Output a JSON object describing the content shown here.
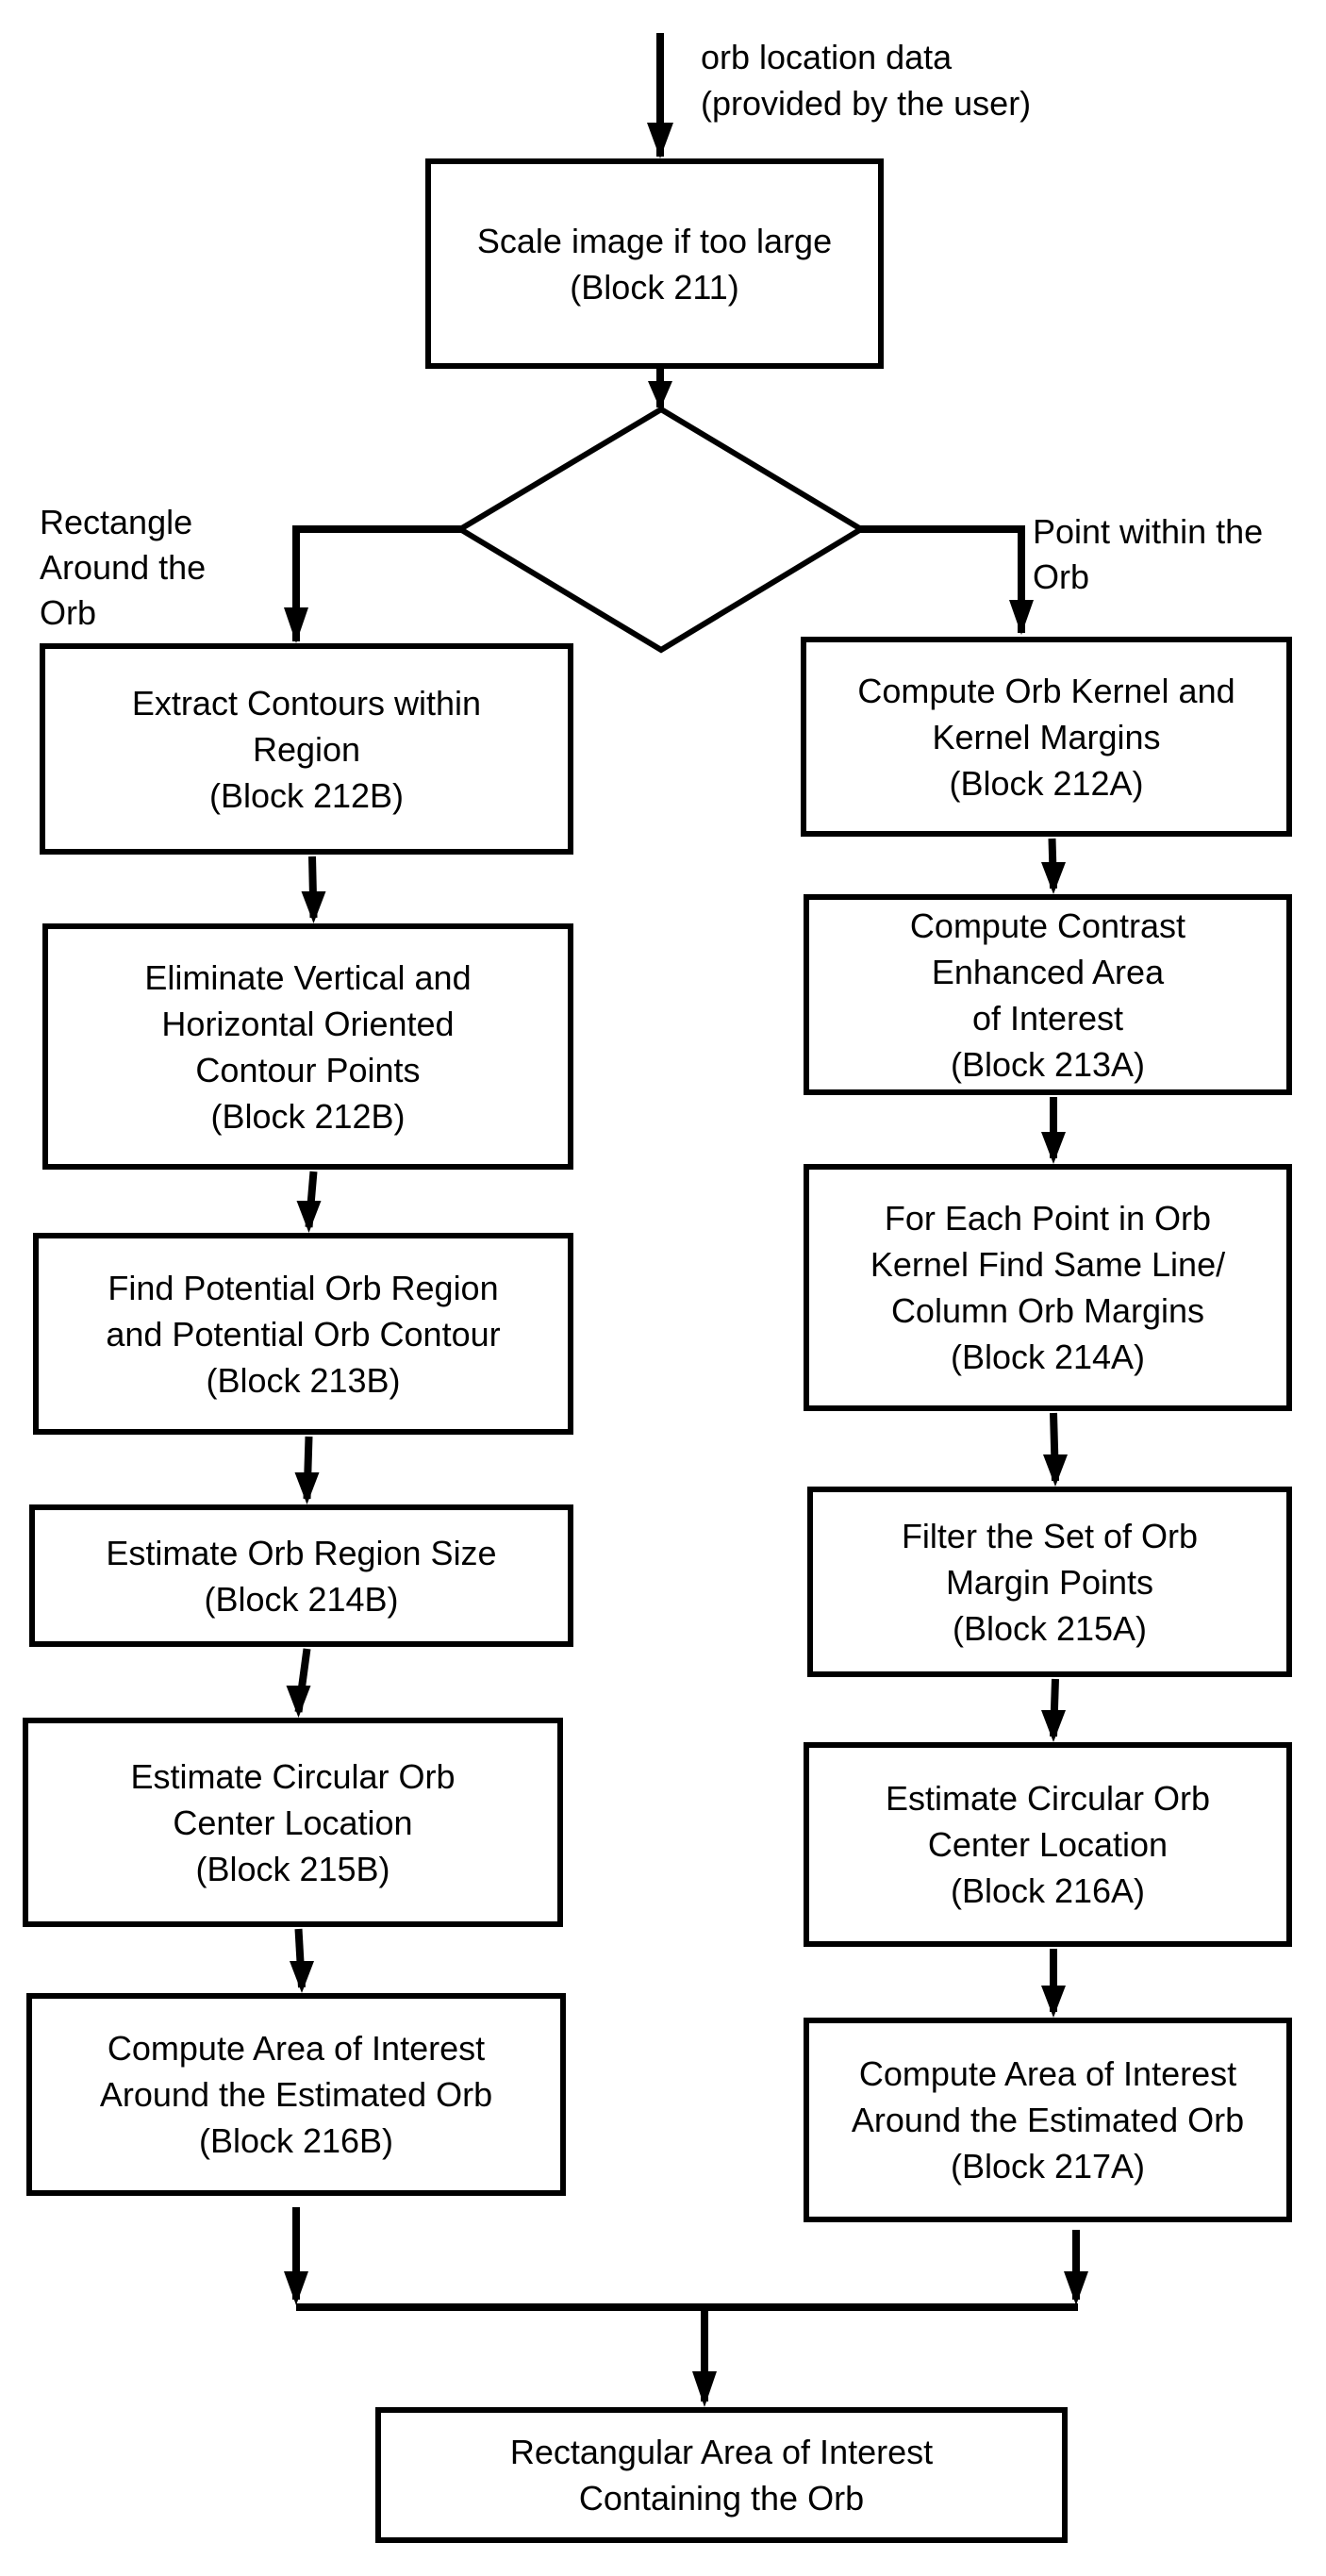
{
  "diagram": {
    "type": "flowchart",
    "input_label": [
      "orb location data",
      "(provided by the user)"
    ],
    "start_block": {
      "id": "211",
      "lines": [
        "Scale image if too large",
        "(Block 211)"
      ]
    },
    "decision": {
      "left_branch_label": [
        "Rectangle",
        "Around the",
        "Orb"
      ],
      "right_branch_label": [
        "Point within the",
        "Orb"
      ]
    },
    "left_branch": [
      {
        "id": "212B-1",
        "lines": [
          "Extract Contours within",
          "Region",
          "(Block 212B)"
        ]
      },
      {
        "id": "212B-2",
        "lines": [
          "Eliminate Vertical and",
          "Horizontal Oriented",
          "Contour Points",
          "(Block 212B)"
        ]
      },
      {
        "id": "213B",
        "lines": [
          "Find Potential Orb Region",
          "and Potential Orb Contour",
          "(Block 213B)"
        ]
      },
      {
        "id": "214B",
        "lines": [
          "Estimate Orb Region Size",
          "(Block 214B)"
        ]
      },
      {
        "id": "215B",
        "lines": [
          "Estimate Circular Orb",
          "Center Location",
          "(Block 215B)"
        ]
      },
      {
        "id": "216B",
        "lines": [
          "Compute Area of Interest",
          "Around the Estimated Orb",
          "(Block 216B)"
        ]
      }
    ],
    "right_branch": [
      {
        "id": "212A",
        "lines": [
          "Compute Orb Kernel and",
          "Kernel Margins",
          "(Block 212A)"
        ]
      },
      {
        "id": "213A",
        "lines": [
          "Compute Contrast",
          "Enhanced Area",
          "of Interest",
          "(Block 213A)"
        ]
      },
      {
        "id": "214A",
        "lines": [
          "For Each Point in Orb",
          "Kernel Find Same Line/",
          "Column Orb Margins",
          "(Block 214A)"
        ]
      },
      {
        "id": "215A",
        "lines": [
          "Filter the Set of Orb",
          "Margin Points",
          "(Block 215A)"
        ]
      },
      {
        "id": "216A",
        "lines": [
          "Estimate Circular Orb",
          "Center Location",
          "(Block 216A)"
        ]
      },
      {
        "id": "217A",
        "lines": [
          "Compute Area of Interest",
          "Around the Estimated Orb",
          "(Block 217A)"
        ]
      }
    ],
    "end_block": {
      "lines": [
        "Rectangular Area of Interest",
        "Containing the Orb"
      ]
    }
  }
}
